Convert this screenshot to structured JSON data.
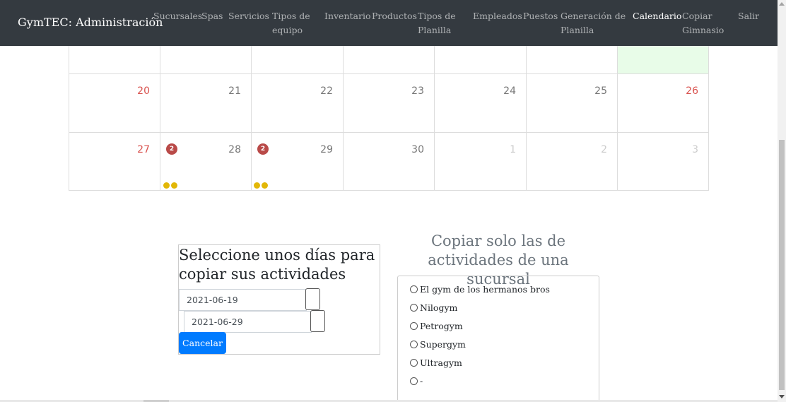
{
  "navbar": {
    "brand": "GymTEC: Administración",
    "items": [
      {
        "label": "Sucursales"
      },
      {
        "label": "Spas"
      },
      {
        "label": "Servicios"
      },
      {
        "label": "Tipos de\nequipo"
      },
      {
        "label": "Inventario"
      },
      {
        "label": "Productos"
      },
      {
        "label": "Tipos de\nPlanilla"
      },
      {
        "label": "Empleados"
      },
      {
        "label": "Puestos"
      },
      {
        "label": "Generación de\nPlanilla"
      },
      {
        "label": "Calendario"
      },
      {
        "label": "Copiar\nGimnasio"
      },
      {
        "label": "Salir"
      }
    ],
    "active": "Calendario"
  },
  "calendar": {
    "rows": [
      {
        "days": [
          "",
          "",
          "",
          "",
          "",
          "",
          ""
        ]
      },
      {
        "days": [
          "20",
          "21",
          "22",
          "23",
          "24",
          "25",
          "26"
        ]
      },
      {
        "days": [
          "27",
          "28",
          "29",
          "30",
          "1",
          "2",
          "3"
        ]
      }
    ],
    "badges": [
      {
        "day": "28",
        "count": "2"
      },
      {
        "day": "29",
        "count": "2"
      }
    ],
    "colors": {
      "weekend": "#d9534f",
      "badge": "#b94a48",
      "event_dot": "#e2b707",
      "today_bg": "#e8fce8"
    }
  },
  "copy_days": {
    "title": "Seleccione unos días para copiar sus actividades",
    "start_date": "2021-06-19",
    "end_date": "2021-06-29",
    "cancel_label": "Cancelar"
  },
  "copy_branch": {
    "title": "Copiar solo las de actividades de una sucursal",
    "options": [
      {
        "label": "El gym de los hermanos bros"
      },
      {
        "label": "Nilogym"
      },
      {
        "label": "Petrogym"
      },
      {
        "label": "Supergym"
      },
      {
        "label": "Ultragym"
      },
      {
        "label": "-"
      }
    ]
  }
}
